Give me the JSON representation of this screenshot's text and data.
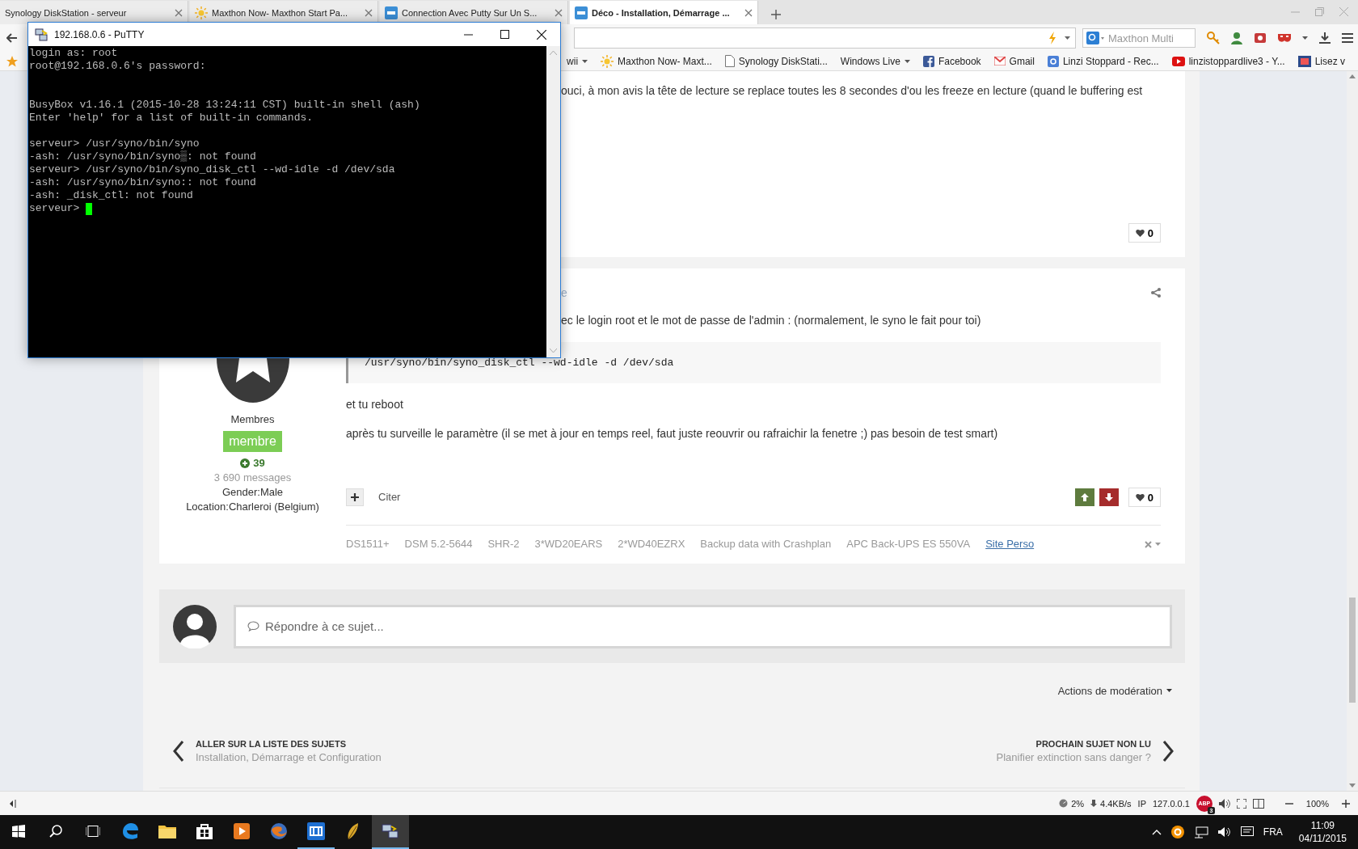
{
  "browser": {
    "tabs": [
      {
        "title": "Synology DiskStation - serveur",
        "selected": false
      },
      {
        "title": "Maxthon Now- Maxthon Start Pa...",
        "selected": false
      },
      {
        "title": "Connection Avec Putty Sur Un S...",
        "selected": false
      },
      {
        "title": "Déco - Installation, Démarrage ...",
        "selected": true
      }
    ],
    "search_placeholder": "Maxthon Multi"
  },
  "bookmarks": [
    {
      "label": "wii",
      "has_menu": true
    },
    {
      "label": "Maxthon Now- Maxt...",
      "has_menu": false
    },
    {
      "label": "Synology DiskStati...",
      "has_menu": false
    },
    {
      "label": "Windows Live",
      "has_menu": true
    },
    {
      "label": "Facebook",
      "has_menu": false
    },
    {
      "label": "Gmail",
      "has_menu": false
    },
    {
      "label": "Linzi Stoppard - Rec...",
      "has_menu": false
    },
    {
      "label": "linzistoppardlive3 - Y...",
      "has_menu": false
    },
    {
      "label": "Lisez v",
      "has_menu": false
    }
  ],
  "putty": {
    "title": "192.168.0.6 - PuTTY",
    "blocks": [
      [
        "login as: root",
        "root@192.168.0.6's password:"
      ],
      [
        "BusyBox v1.16.1 (2015-10-28 13:24:11 CST) built-in shell (ash)",
        "Enter 'help' for a list of built-in commands."
      ],
      [
        "serveur> /usr/syno/bin/syno",
        "-ash: /usr/syno/bin/syno▒: not found",
        "serveur> /usr/syno/bin/syno_disk_ctl --wd-idle -d /dev/sda",
        "-ash: /usr/syno/bin/syno:: not found",
        "-ash: _disk_ctl: not found",
        "serveur>"
      ]
    ]
  },
  "posts": [
    {
      "body": [
        {
          "kind": "text",
          "text": "ouci, à mon avis la tête de lecture se replace toutes les 8 secondes d'ou les freeze en lecture (quand le buffering est"
        }
      ],
      "likes": "0"
    },
    {
      "meta_fragment": "e",
      "author": {
        "group": "Membres",
        "badge": "membre",
        "reputation": "39",
        "messages": "3 690 messages",
        "gender": "Gender:Male",
        "location": "Location:Charleroi (Belgium)"
      },
      "body": [
        {
          "kind": "text",
          "text": "ec le login root et le mot de passe de l'admin : (normalement, le syno le fait pour toi)"
        },
        {
          "kind": "code",
          "text": "/usr/syno/bin/syno_disk_ctl --wd-idle -d /dev/sda"
        },
        {
          "kind": "text",
          "text": "et tu reboot"
        },
        {
          "kind": "text",
          "text": "après tu surveille le paramètre (il se met à jour en temps reel, faut juste reouvrir ou rafraichir la fenetre ;) pas besoin de test smart)"
        }
      ],
      "quote_label": "Citer",
      "likes": "0",
      "signature": [
        {
          "text": "DS1511+",
          "link": false
        },
        {
          "text": "DSM 5.2-5644",
          "link": false
        },
        {
          "text": "SHR-2",
          "link": false
        },
        {
          "text": "3*WD20EARS",
          "link": false
        },
        {
          "text": "2*WD40EZRX",
          "link": false
        },
        {
          "text": "Backup data with Crashplan",
          "link": false
        },
        {
          "text": "APC Back-UPS ES 550VA",
          "link": false
        },
        {
          "text": "Site Perso",
          "link": true
        }
      ]
    }
  ],
  "reply": {
    "placeholder": "Répondre à ce sujet..."
  },
  "moderation_label": "Actions de modération",
  "navigation": {
    "previous": {
      "heading": "ALLER SUR LA LISTE DES SUJETS",
      "title": "Installation, Démarrage et Configuration"
    },
    "next": {
      "heading": "PROCHAIN SUJET NON LU",
      "title": "Planifier extinction sans danger ?"
    }
  },
  "status_bar": {
    "cpu": "2%",
    "speed": "4.4KB/s",
    "ip_label": "IP",
    "ip": "127.0.0.1",
    "adblock_label": "ABP",
    "adblock_count": "3",
    "zoom": "100%"
  },
  "taskbar": {
    "apps": [
      {
        "open": false,
        "selected": false
      },
      {
        "open": false,
        "selected": false
      },
      {
        "open": false,
        "selected": false
      },
      {
        "open": false,
        "selected": false
      },
      {
        "open": false,
        "selected": false
      },
      {
        "open": true,
        "selected": false
      },
      {
        "open": false,
        "selected": false
      },
      {
        "open": true,
        "selected": true
      }
    ],
    "language": "FRA",
    "time": "11:09",
    "date": "04/11/2015"
  }
}
